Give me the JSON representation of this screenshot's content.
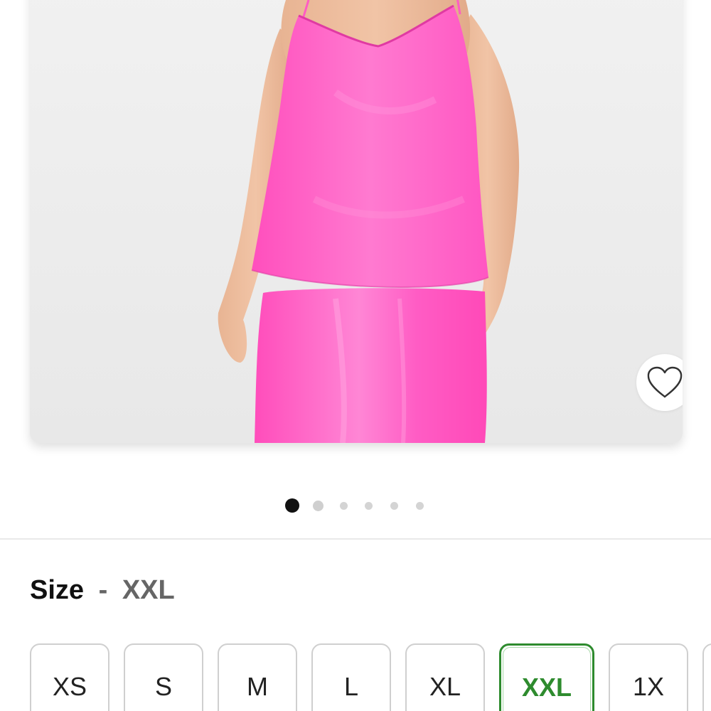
{
  "product_image": {
    "alt_icon": "product-photo",
    "wishlist_icon": "heart-icon"
  },
  "carousel": {
    "total": 6,
    "active_index": 0
  },
  "size_selector": {
    "label": "Size",
    "separator": "-",
    "selected_value": "XXL",
    "options": [
      "XS",
      "S",
      "M",
      "L",
      "XL",
      "XXL",
      "1X"
    ],
    "selected_color": "#2e8b2e"
  },
  "colors": {
    "accent_pink": "#ff5cc4",
    "selected_green": "#2e8b2e"
  }
}
